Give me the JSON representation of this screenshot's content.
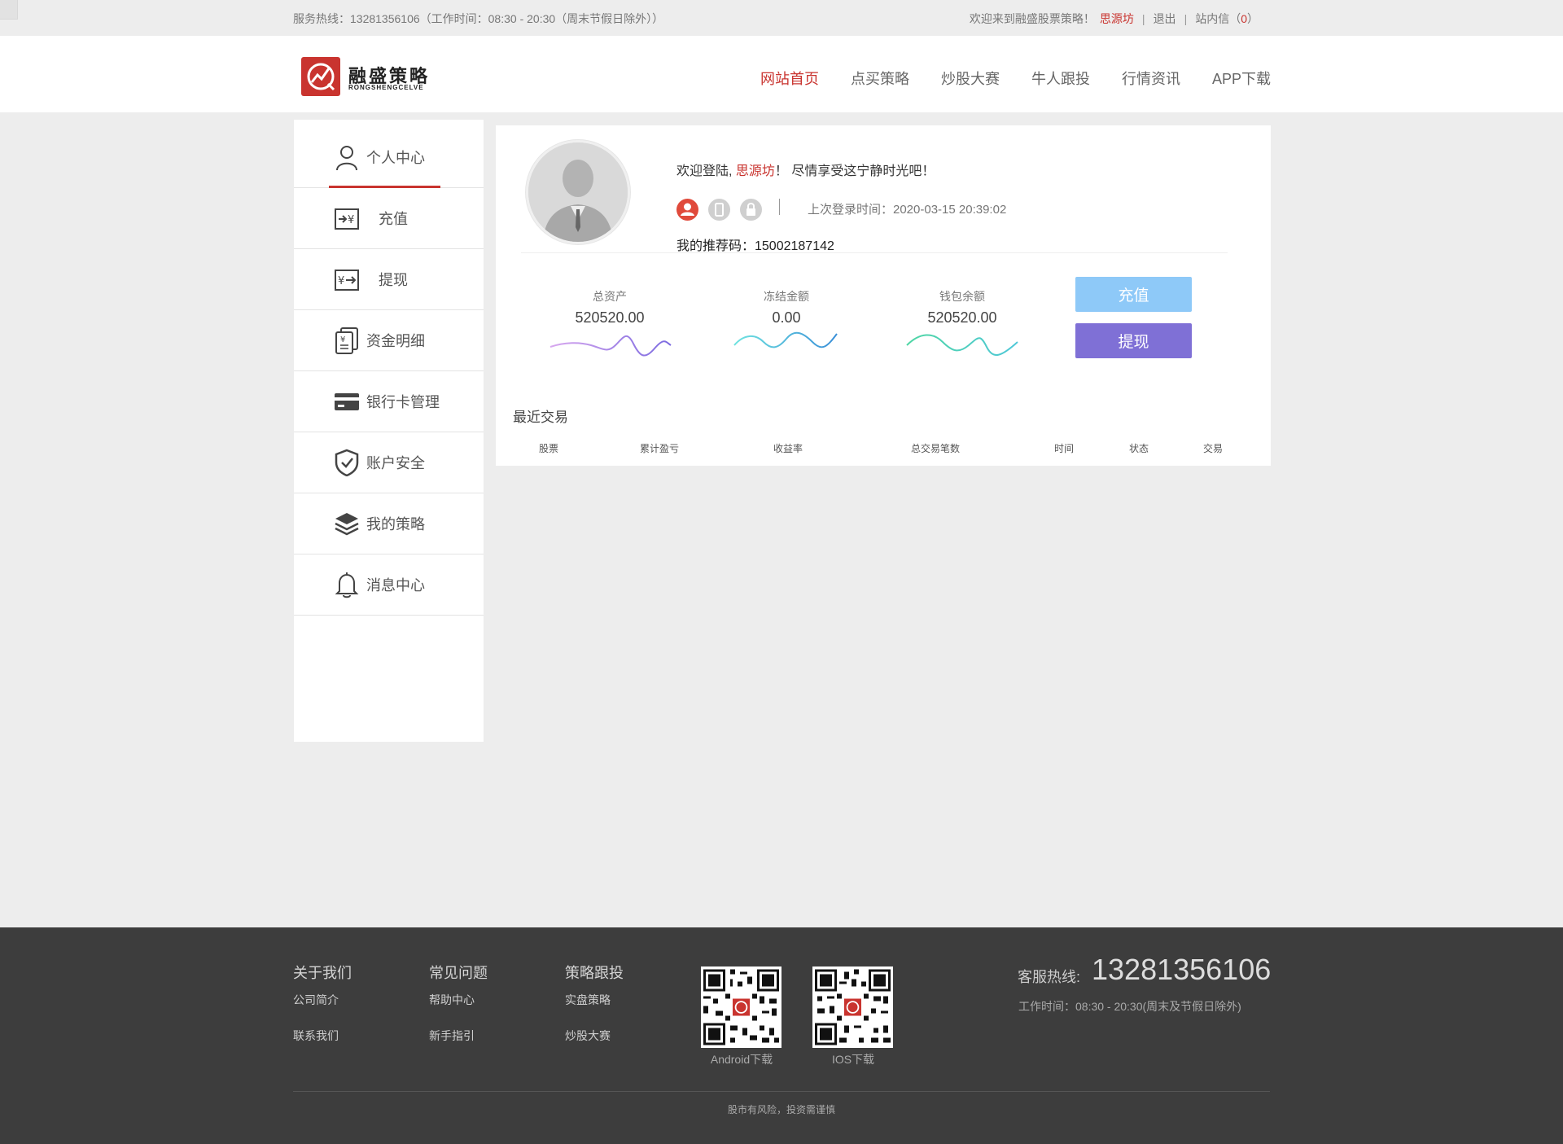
{
  "topbar": {
    "hotline": "服务热线：13281356106（工作时间：08:30 - 20:30（周末节假日除外））",
    "welcome": "欢迎来到融盛股票策略！",
    "username": "思源坊",
    "logout": "退出",
    "sep": "|",
    "inbox": "站内信",
    "inbox_open": "（",
    "inbox_count": "0",
    "inbox_close": "）"
  },
  "header": {
    "logo_cn": "融盛策略",
    "logo_en": "RONGSHENGCELVE",
    "nav": [
      "网站首页",
      "点买策略",
      "炒股大赛",
      "牛人跟投",
      "行情资讯",
      "APP下载"
    ]
  },
  "sidebar": {
    "items": [
      {
        "label": "个人中心",
        "icon": "user-icon"
      },
      {
        "label": "充值",
        "icon": "recharge-icon"
      },
      {
        "label": "提现",
        "icon": "withdraw-icon"
      },
      {
        "label": "资金明细",
        "icon": "fund-details-icon"
      },
      {
        "label": "银行卡管理",
        "icon": "bank-card-icon"
      },
      {
        "label": "账户安全",
        "icon": "shield-icon"
      },
      {
        "label": "我的策略",
        "icon": "layers-icon"
      },
      {
        "label": "消息中心",
        "icon": "bell-icon"
      }
    ]
  },
  "profile": {
    "welcome_prefix": "欢迎登陆,",
    "username": "思源坊",
    "welcome_suffix": "！ 尽情享受这宁静时光吧！",
    "last_login": "上次登录时间：2020-03-15 20:39:02",
    "referral": "我的推荐码：15002187142"
  },
  "stats": [
    {
      "label": "总资产",
      "value": "520520.00",
      "color": "#b084e0"
    },
    {
      "label": "冻结金额",
      "value": "0.00",
      "color": "#5bc0e8"
    },
    {
      "label": "钱包余额",
      "value": "520520.00",
      "color": "#4fd6b8"
    }
  ],
  "actions": {
    "recharge": "充值",
    "withdraw": "提现"
  },
  "recent": {
    "title": "最近交易",
    "columns": [
      "股票",
      "累计盈亏",
      "收益率",
      "总交易笔数",
      "时间",
      "状态",
      "交易"
    ]
  },
  "footer": {
    "cols": [
      {
        "title": "关于我们",
        "links": [
          "公司简介",
          "联系我们"
        ]
      },
      {
        "title": "常见问题",
        "links": [
          "帮助中心",
          "新手指引"
        ]
      },
      {
        "title": "策略跟投",
        "links": [
          "实盘策略",
          "炒股大赛"
        ]
      }
    ],
    "qr": [
      "Android下载",
      "IOS下载"
    ],
    "hotline_label": "客服热线:",
    "hotline_number": "13281356106",
    "worktime": "工作时间：08:30 - 20:30(周末及节假日除外)",
    "risk": "股市有风险，投资需谨慎"
  },
  "colors": {
    "accent": "#c9342f",
    "recharge": "#8ec9f8",
    "withdraw": "#7f70d6",
    "footer": "#3d3d3d"
  }
}
